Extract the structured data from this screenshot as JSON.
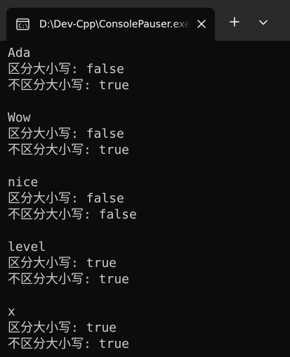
{
  "window": {
    "tab_title": "D:\\Dev-Cpp\\ConsolePauser.exe",
    "tab_icon": "console-app-icon",
    "close_icon": "close-icon",
    "new_tab_icon": "plus-icon",
    "dropdown_icon": "chevron-down-icon"
  },
  "colors": {
    "tabbar_background": "#2a2a2a",
    "console_background": "#0c0c0c",
    "console_text": "#cccccc",
    "tab_text": "#ffffff"
  },
  "console": {
    "lines": [
      "Ada",
      "区分大小写: false",
      "不区分大小写: true",
      "",
      "Wow",
      "区分大小写: false",
      "不区分大小写: true",
      "",
      "nice",
      "区分大小写: false",
      "不区分大小写: false",
      "",
      "level",
      "区分大小写: true",
      "不区分大小写: true",
      "",
      "x",
      "区分大小写: true",
      "不区分大小写: true"
    ]
  }
}
